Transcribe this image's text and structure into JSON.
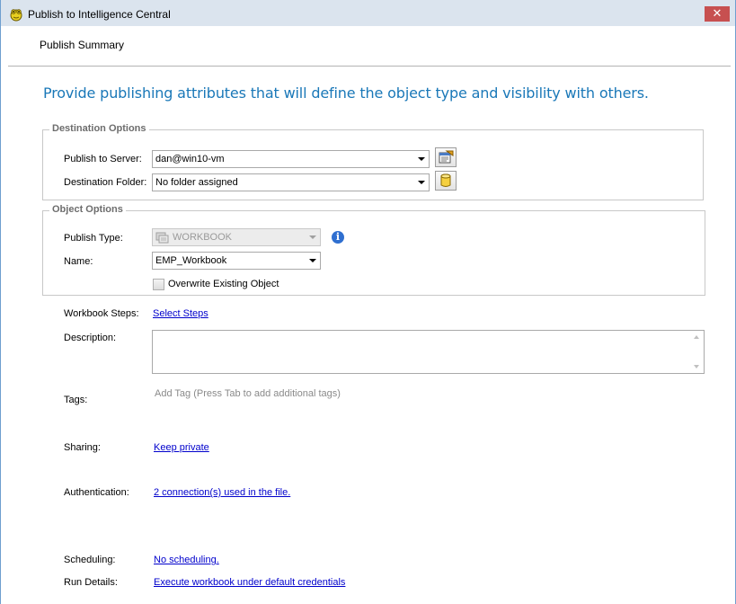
{
  "window": {
    "title": "Publish to Intelligence Central",
    "close_label": "✕"
  },
  "tab": {
    "label": "Publish Summary"
  },
  "headline": "Provide publishing attributes that will define the object type and visibility with others.",
  "destination": {
    "title": "Destination Options",
    "server_label": "Publish to Server:",
    "server_value": "dan@win10-vm",
    "folder_label": "Destination Folder:",
    "folder_value": "No folder assigned"
  },
  "object": {
    "title": "Object Options",
    "type_label": "Publish Type:",
    "type_value": "WORKBOOK",
    "name_label": "Name:",
    "name_value": "EMP_Workbook",
    "overwrite_label": "Overwrite Existing Object",
    "overwrite_checked": false
  },
  "details": {
    "steps_label": "Workbook Steps:",
    "steps_link": "Select Steps",
    "description_label": "Description:",
    "description_value": "",
    "tags_label": "Tags:",
    "tags_placeholder": "Add Tag (Press Tab to add additional tags)",
    "sharing_label": "Sharing:",
    "sharing_link": "Keep private",
    "auth_label": "Authentication:",
    "auth_link": "2 connection(s) used in the file.",
    "scheduling_label": "Scheduling:",
    "scheduling_link": "No scheduling.",
    "run_label": "Run Details:",
    "run_link": "Execute workbook under default credentials"
  },
  "colors": {
    "headline": "#1a78b8",
    "link": "#0000cc",
    "close": "#c75050",
    "titlebar": "#dbe4ee"
  }
}
